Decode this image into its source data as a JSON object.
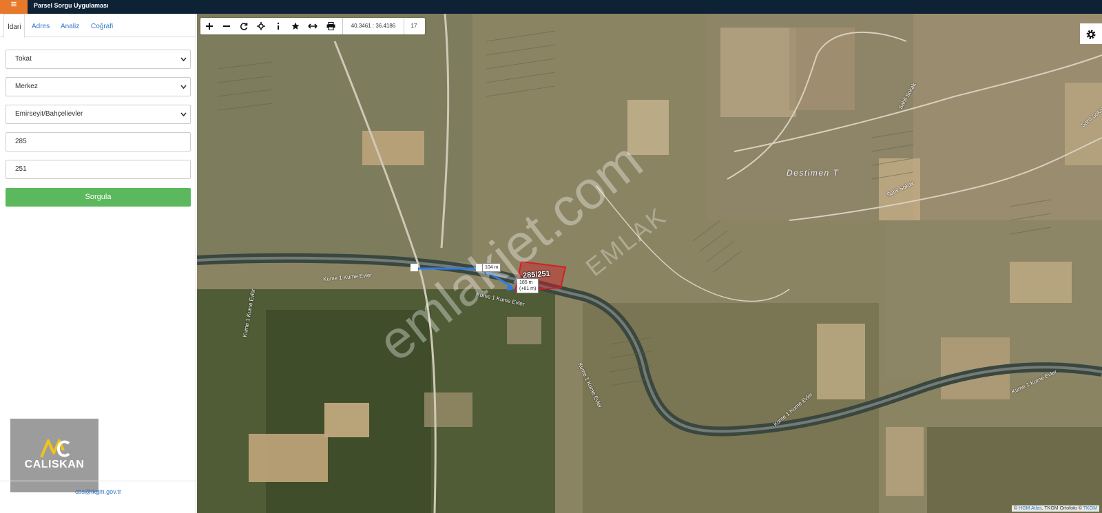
{
  "header": {
    "menu_icon": "hamburger-icon",
    "menu_glyph": "≡",
    "title": "Parsel Sorgu Uygulaması"
  },
  "sidebar": {
    "tabs": [
      {
        "label": "İdari",
        "active": true
      },
      {
        "label": "Adres",
        "active": false
      },
      {
        "label": "Analiz",
        "active": false
      },
      {
        "label": "Coğrafi",
        "active": false
      }
    ],
    "il": "Tokat",
    "ilce": "Merkez",
    "mahalle": "Emirseyit/Bahçelievler",
    "ada": "285",
    "parsel": "251",
    "query_button": "Sorgula",
    "logo_text": "CALISKAN",
    "email": "cbs@tkgm.gov.tr"
  },
  "map": {
    "toolbar": {
      "buttons": [
        "zoom-in-icon",
        "zoom-out-icon",
        "refresh-icon",
        "locate-icon",
        "info-icon",
        "star-icon",
        "measure-icon",
        "print-icon"
      ],
      "coordinates": "40.3461 : 36.4186",
      "zoom_level": "17"
    },
    "parcel_label": "285/251",
    "measure_distance": "104 m",
    "measure_distance2": "185 m",
    "measure_elevation": "(+61 m)",
    "road_names": [
      "Kume 1 Kume Evler",
      "Kume 1 Kume Evler",
      "Kume 1 Kume Evler",
      "Kume 1 Kume Evler",
      "Kume 1 Kume Evler",
      "Kume 1 Kume Evler",
      "Sahil Sokak",
      "Sahil Sokak",
      "Sahil Sokak"
    ],
    "place_name": "Destimen T",
    "watermark": "emlakjet.com",
    "watermark_sub": "EMLAK",
    "attribution_prefix": "©",
    "attribution_link1": "HGM Atlas",
    "attribution_mid": ", TKGM Ortofoto ©",
    "attribution_link2": "TKGM"
  },
  "colors": {
    "topbar": "#0e2236",
    "menu": "#e8792b",
    "button": "#5cb85c",
    "parcel": "#d11f2a",
    "measure": "#2e7de1",
    "link": "#3178c6"
  }
}
